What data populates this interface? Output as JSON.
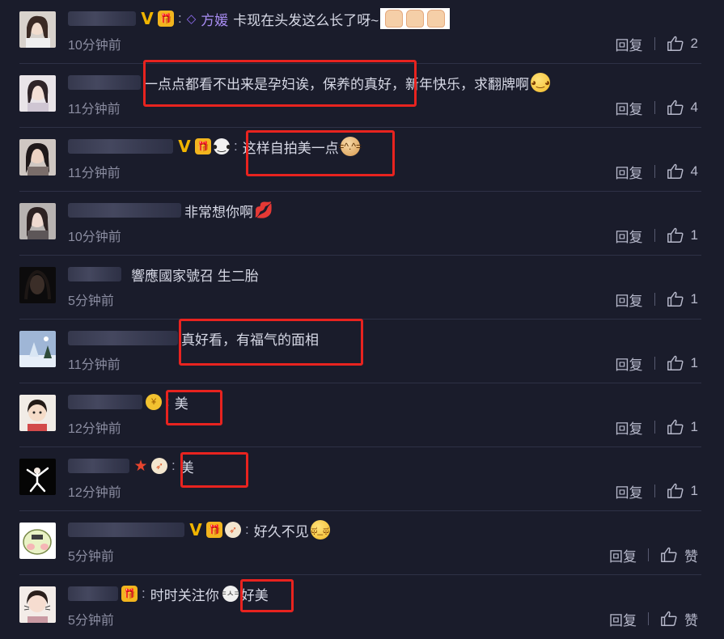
{
  "comments": [
    {
      "time": "10分钟前",
      "mention": "方媛",
      "text": "卡现在头发这么长了呀~",
      "reply_label": "回复",
      "likes": "2"
    },
    {
      "time": "11分钟前",
      "text": "一点点都看不出来是孕妇诶，保养的真好，新年快乐，求翻牌啊",
      "reply_label": "回复",
      "likes": "4"
    },
    {
      "time": "11分钟前",
      "text": "这样自拍美一点",
      "reply_label": "回复",
      "likes": "4"
    },
    {
      "time": "10分钟前",
      "text": "非常想你啊",
      "reply_label": "回复",
      "likes": "1"
    },
    {
      "time": "5分钟前",
      "text": "響應國家號召 生二胎",
      "reply_label": "回复",
      "likes": "1"
    },
    {
      "time": "11分钟前",
      "text": "真好看，有福气的面相",
      "reply_label": "回复",
      "likes": "1"
    },
    {
      "time": "12分钟前",
      "text": "美",
      "reply_label": "回复",
      "likes": "1"
    },
    {
      "time": "12分钟前",
      "text": "美",
      "reply_label": "回复",
      "likes": "1"
    },
    {
      "time": "5分钟前",
      "text": "好久不见",
      "reply_label": "回复",
      "likes": "赞"
    },
    {
      "time": "5分钟前",
      "text": "时时关注你",
      "text2": "好美",
      "reply_label": "回复",
      "likes": "赞"
    }
  ],
  "colors": {
    "background": "#1a1c2b",
    "highlight_box": "#e8231f",
    "mention": "#a88cf2",
    "vip": "#f0b400"
  }
}
